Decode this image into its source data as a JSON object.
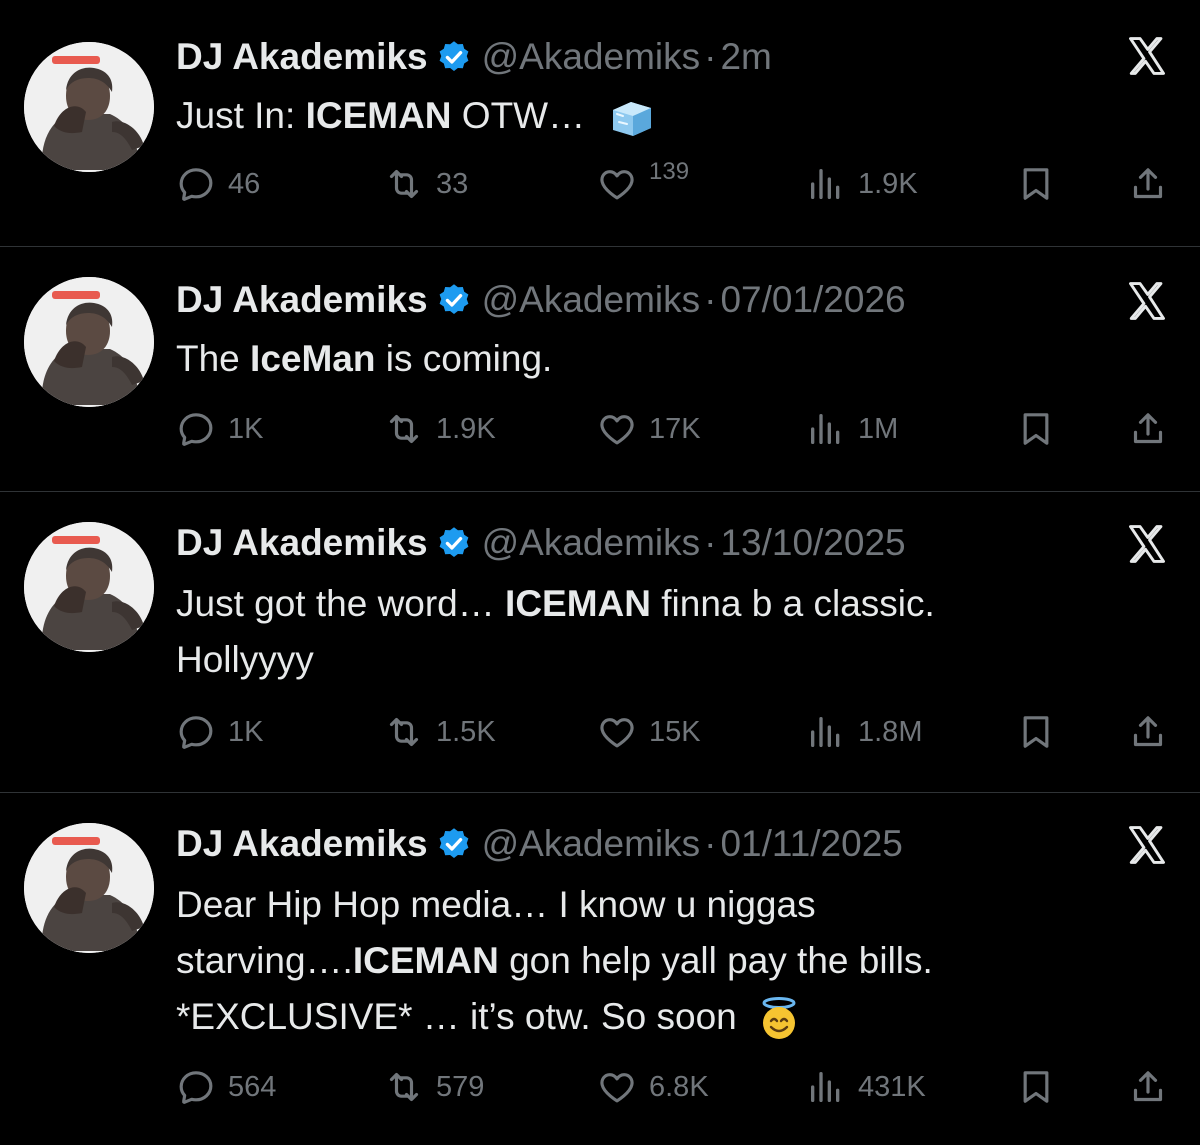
{
  "tweets": [
    {
      "name": "DJ Akademiks",
      "handle": "@Akademiks",
      "separator": "·",
      "time": "2m",
      "text_parts": [
        {
          "t": "Just In: ",
          "bold": false
        },
        {
          "t": "ICEMAN",
          "bold": true
        },
        {
          "t": " OTW…",
          "bold": false
        }
      ],
      "emoji": "ice-cube",
      "replies": "46",
      "reposts": "33",
      "likes": "139",
      "views": "1.9K"
    },
    {
      "name": "DJ Akademiks",
      "handle": "@Akademiks",
      "separator": "·",
      "time": "07/01/2026",
      "text_parts": [
        {
          "t": "The ",
          "bold": false
        },
        {
          "t": "IceMan",
          "bold": true
        },
        {
          "t": " is coming.",
          "bold": false
        }
      ],
      "replies": "1K",
      "reposts": "1.9K",
      "likes": "17K",
      "views": "1M"
    },
    {
      "name": "DJ Akademiks",
      "handle": "@Akademiks",
      "separator": "·",
      "time": "13/10/2025",
      "lines": [
        [
          {
            "t": "Just got the word… ",
            "bold": false
          },
          {
            "t": "ICEMAN",
            "bold": true
          },
          {
            "t": " finna b a classic.",
            "bold": false
          }
        ],
        [
          {
            "t": "Hollyyyy",
            "bold": false
          }
        ]
      ],
      "replies": "1K",
      "reposts": "1.5K",
      "likes": "15K",
      "views": "1.8M"
    },
    {
      "name": "DJ Akademiks",
      "handle": "@Akademiks",
      "separator": "·",
      "time": "01/11/2025",
      "lines": [
        [
          {
            "t": "Dear Hip Hop media… I know u niggas",
            "bold": false
          }
        ],
        [
          {
            "t": "starving….",
            "bold": false
          },
          {
            "t": "ICEMAN",
            "bold": true
          },
          {
            "t": " gon help yall pay the bills.",
            "bold": false
          }
        ],
        [
          {
            "t": "*EXCLUSIVE* … it’s otw. So soon",
            "bold": false
          }
        ]
      ],
      "emoji": "smiling-face-with-halo",
      "replies": "564",
      "reposts": "579",
      "likes": "6.8K",
      "views": "431K"
    }
  ],
  "colors": {
    "background": "#000000",
    "text": "#e7e9ea",
    "muted": "#71767b",
    "verified": "#1d9bf0",
    "divider": "#2f3336"
  },
  "icons": [
    "verified-badge-icon",
    "x-logo-icon",
    "reply-icon",
    "repost-icon",
    "like-icon",
    "views-icon",
    "bookmark-icon",
    "share-icon"
  ]
}
